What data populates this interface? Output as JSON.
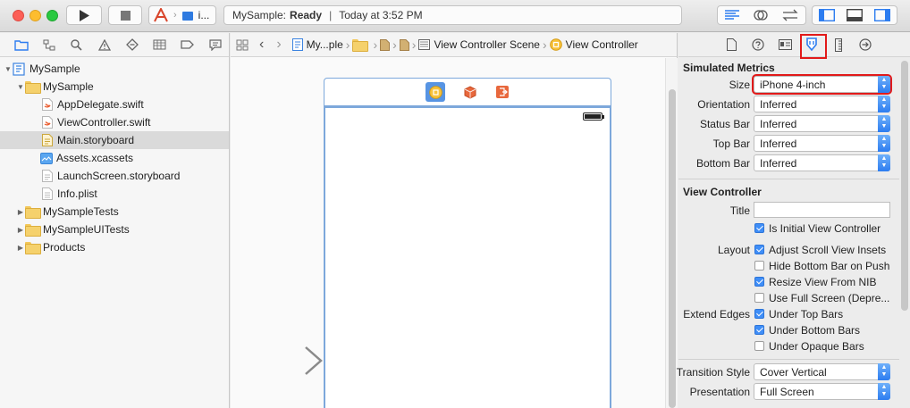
{
  "toolbar": {
    "scheme_name": "i...",
    "activity": {
      "project": "MySample:",
      "status": "Ready",
      "separator": "|",
      "timestamp": "Today at 3:52 PM"
    }
  },
  "navigator": {
    "tree": [
      {
        "label": "MySample",
        "kind": "project",
        "level": 0,
        "disclosure": "open"
      },
      {
        "label": "MySample",
        "kind": "folder",
        "level": 1,
        "disclosure": "open"
      },
      {
        "label": "AppDelegate.swift",
        "kind": "swift",
        "level": 2
      },
      {
        "label": "ViewController.swift",
        "kind": "swift",
        "level": 2
      },
      {
        "label": "Main.storyboard",
        "kind": "storyboard",
        "level": 2,
        "selected": true
      },
      {
        "label": "Assets.xcassets",
        "kind": "assets",
        "level": 2
      },
      {
        "label": "LaunchScreen.storyboard",
        "kind": "storyboard",
        "level": 2
      },
      {
        "label": "Info.plist",
        "kind": "plist",
        "level": 2
      },
      {
        "label": "MySampleTests",
        "kind": "folder",
        "level": 1,
        "disclosure": "closed"
      },
      {
        "label": "MySampleUITests",
        "kind": "folder",
        "level": 1,
        "disclosure": "closed"
      },
      {
        "label": "Products",
        "kind": "folder",
        "level": 1,
        "disclosure": "closed"
      }
    ]
  },
  "jumpbar": {
    "items": [
      "My...ple",
      "View Controller Scene",
      "View Controller"
    ]
  },
  "inspector": {
    "simulated_metrics": {
      "title": "Simulated Metrics",
      "fields": [
        {
          "label": "Size",
          "value": "iPhone 4-inch",
          "highlight": true
        },
        {
          "label": "Orientation",
          "value": "Inferred"
        },
        {
          "label": "Status Bar",
          "value": "Inferred"
        },
        {
          "label": "Top Bar",
          "value": "Inferred"
        },
        {
          "label": "Bottom Bar",
          "value": "Inferred"
        }
      ]
    },
    "view_controller": {
      "title": "View Controller",
      "title_label": "Title",
      "title_value": "",
      "initial_label": "Is Initial View Controller",
      "initial_checked": true,
      "layout_label": "Layout",
      "layout_options": [
        {
          "label": "Adjust Scroll View Insets",
          "checked": true
        },
        {
          "label": "Hide Bottom Bar on Push",
          "checked": false
        },
        {
          "label": "Resize View From NIB",
          "checked": true
        },
        {
          "label": "Use Full Screen (Depre...",
          "checked": false
        }
      ],
      "extend_label": "Extend Edges",
      "extend_options": [
        {
          "label": "Under Top Bars",
          "checked": true
        },
        {
          "label": "Under Bottom Bars",
          "checked": true
        },
        {
          "label": "Under Opaque Bars",
          "checked": false
        }
      ],
      "transition_label": "Transition Style",
      "transition_value": "Cover Vertical",
      "presentation_label": "Presentation",
      "presentation_value": "Full Screen"
    }
  },
  "colors": {
    "accent": "#3f8ef7",
    "highlight": "#e21a1a",
    "device_outline": "#7da8db"
  }
}
